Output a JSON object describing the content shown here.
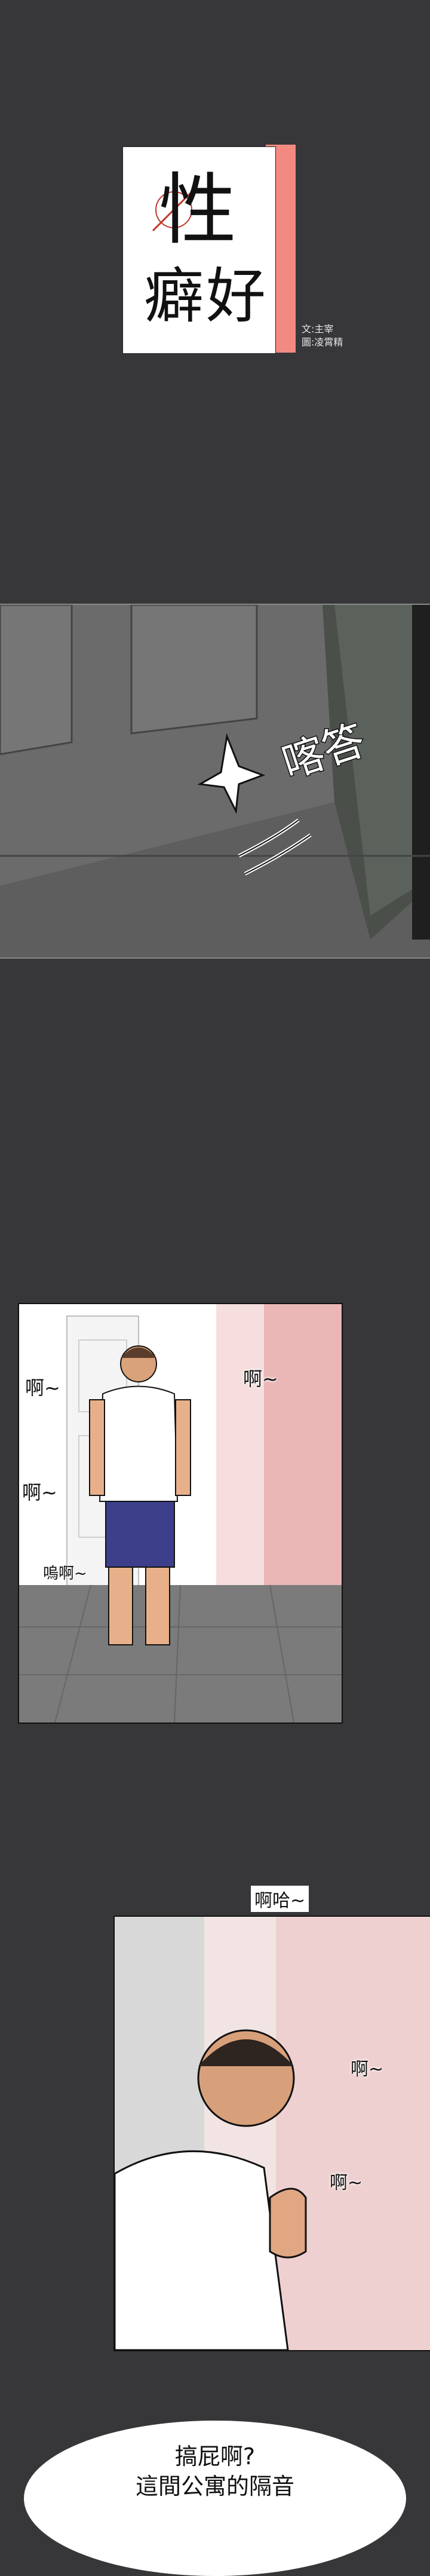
{
  "title": {
    "main": "性",
    "sub": "癖好",
    "credits": {
      "line1": "文:主宰",
      "line2": "圖:凌霄精"
    }
  },
  "panel_door": {
    "sfx": "喀答"
  },
  "panel_room": {
    "moans": [
      {
        "text": "啊~"
      },
      {
        "text": "啊~"
      },
      {
        "text": "啊~"
      },
      {
        "text": "嗚啊~"
      }
    ]
  },
  "panel_man": {
    "moans": [
      {
        "text": "啊哈~"
      },
      {
        "text": "啊~"
      },
      {
        "text": "啊~"
      }
    ]
  },
  "speech": {
    "line1": "搞屁啊?",
    "line2": "這間公寓的隔音"
  },
  "colors": {
    "background": "#37373a",
    "title_stripe": "#f28a82",
    "ink": "#111111"
  }
}
